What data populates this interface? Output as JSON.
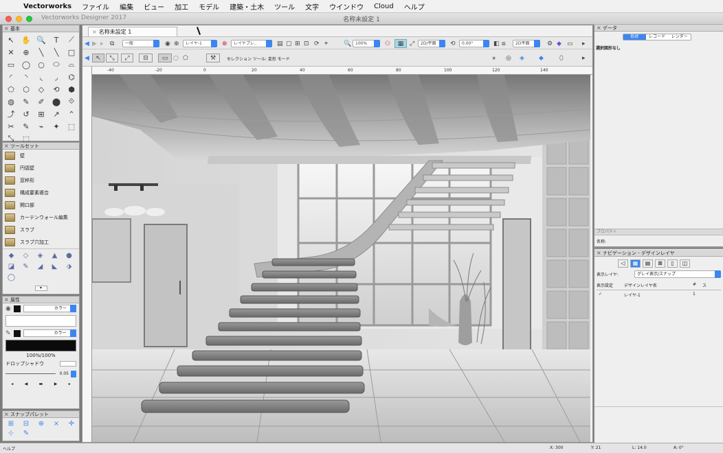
{
  "menubar": {
    "apple": "",
    "items": [
      "Vectorworks",
      "ファイル",
      "編集",
      "ビュー",
      "加工",
      "モデル",
      "建築・土木",
      "ツール",
      "文字",
      "ウインドウ",
      "Cloud",
      "ヘルプ"
    ]
  },
  "window": {
    "app_title": "Vectorworks Designer 2017",
    "title": "名称未設定 1"
  },
  "document": {
    "tab": "名称未設定 1"
  },
  "view_bar": {
    "class_dropdown": "一般",
    "layer_dropdown": "レイヤ-1",
    "layer_dropdown2": "レイヤプレ..",
    "zoom": "100%",
    "view_dropdown": "2D/平面",
    "angle": "0.00°",
    "render_dropdown": "2D平面"
  },
  "mode_bar": {
    "mode_label": "セレクション ツール: 変形 モード"
  },
  "ruler": {
    "ticks": [
      "-40",
      "-20",
      "0",
      "20",
      "40",
      "60",
      "80",
      "100",
      "120",
      "140"
    ]
  },
  "palettes": {
    "basic": {
      "title": "基本",
      "tools": [
        "↖",
        "✋",
        "🔍",
        "T",
        "⟋",
        "✕",
        "⊕",
        "╲",
        "╲",
        "□",
        "▭",
        "◯",
        "○",
        "⬭",
        "⌓",
        "◜",
        "◝",
        "◟",
        "◞",
        "⌬",
        "⬠",
        "⬡",
        "◇",
        "⟲",
        "⬢",
        "◍",
        "✎",
        "✐",
        "⬤",
        "⟐",
        "⤴",
        "↺",
        "⊞",
        "↗",
        "⌃",
        "✂",
        "✎",
        "⌁",
        "✦",
        "⬚",
        "⤡",
        "⬚"
      ]
    },
    "toolset": {
      "title": "ツールセット",
      "items": [
        "壁",
        "円弧壁",
        "窓枠形",
        "構成要素複合",
        "開口部",
        "カーテンウォール編集",
        "スラブ",
        "スラブ穴加工"
      ]
    },
    "toolset_tabs": [
      "◆",
      "◇",
      "◈",
      "▲",
      "●",
      "◪",
      "✎",
      "◢",
      "◣",
      "⬗",
      "◯"
    ],
    "attributes": {
      "title": "属性",
      "fill_label": "カラー",
      "pen_label": "カラー",
      "opacity": "100%/100%",
      "shadow_label": "ドロップシャドウ",
      "line_value": "0.05"
    },
    "snapping": {
      "title": "スナップパレット",
      "icons": [
        "⊞",
        "⊟",
        "⊕",
        "⨯",
        "✛",
        "⊹",
        "✎"
      ]
    }
  },
  "right_panel": {
    "data_title": "データ",
    "data_tabs": [
      "形状",
      "レコード",
      "レンダー"
    ],
    "no_selection": "選択図形なし",
    "info_label": "名称:",
    "info_title": "プロパティ",
    "nav_title": "ナビゲーション - デザインレイヤ",
    "layer_label": "表示レイヤ:",
    "layer_mode": "グレイ表示/スナップ",
    "table_headers": [
      "表示設定",
      "デザインレイヤ名",
      "#",
      "ス"
    ],
    "table_rows": [
      {
        "check": "✓",
        "name": "レイヤ-1",
        "num": "1",
        "st": ""
      }
    ]
  },
  "statusbar": {
    "help": "ヘルプ",
    "x": "X: 300",
    "y": "Y: 21",
    "l": "L: 14.0",
    "a": "A: 0°"
  }
}
